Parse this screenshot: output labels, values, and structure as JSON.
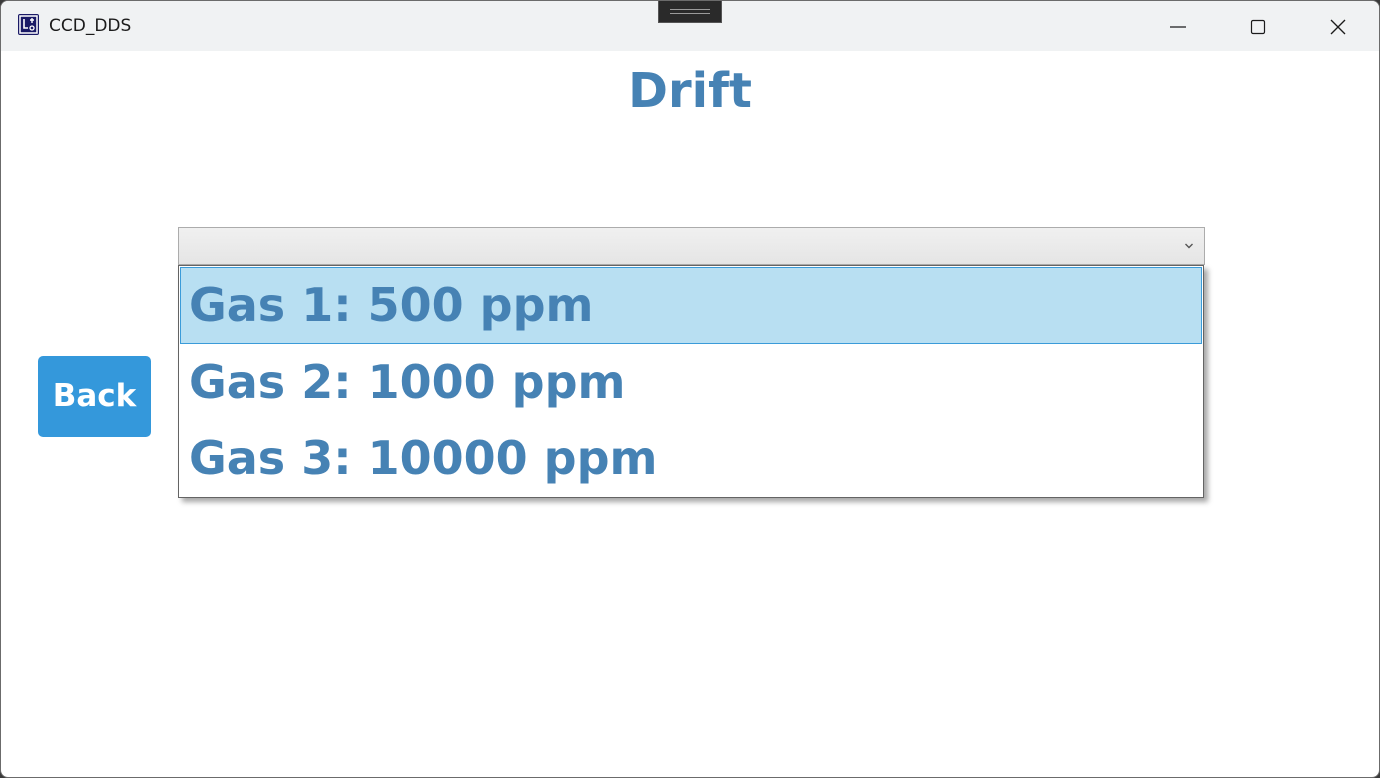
{
  "window": {
    "title": "CCD_DDS",
    "controls": {
      "minimize_icon": "minimize-icon",
      "maximize_icon": "maximize-icon",
      "close_icon": "close-icon"
    }
  },
  "page": {
    "title": "Drift"
  },
  "back_button": {
    "label": "Back"
  },
  "gas_select": {
    "value": "",
    "options": [
      "Gas 1: 500 ppm",
      "Gas 2: 1000 ppm",
      "Gas 3: 10000 ppm"
    ],
    "highlighted_index": 0
  },
  "colors": {
    "accent_text": "#4682b4",
    "button_bg": "#3498db",
    "highlight_bg": "#b8dff2",
    "highlight_border": "#3a9bd9"
  }
}
